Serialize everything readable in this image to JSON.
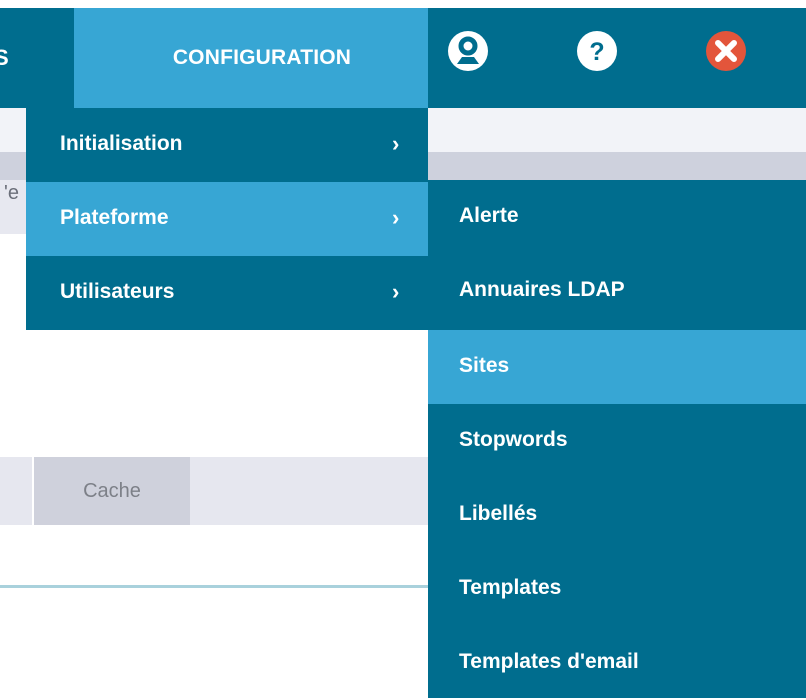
{
  "header": {
    "partial_nav_label": "S",
    "active_nav_label": "CONFIGURATION",
    "icons": [
      "user-icon",
      "help-icon",
      "close-icon"
    ]
  },
  "background": {
    "partial_text": "'e",
    "tab_label": "Cache"
  },
  "menu_level1": {
    "items": [
      {
        "label": "Initialisation",
        "chevron": "›"
      },
      {
        "label": "Plateforme",
        "chevron": "›"
      },
      {
        "label": "Utilisateurs",
        "chevron": "›"
      }
    ],
    "active": "Plateforme"
  },
  "menu_level2": {
    "items": [
      {
        "label": "Alerte"
      },
      {
        "label": "Annuaires LDAP"
      },
      {
        "label": "Sites"
      },
      {
        "label": "Stopwords"
      },
      {
        "label": "Libellés"
      },
      {
        "label": "Templates"
      },
      {
        "label": "Templates d'email"
      }
    ],
    "active": "Sites"
  },
  "colors": {
    "dark_teal": "#006d8e",
    "light_blue": "#37a6d4",
    "close_red": "#e3553b"
  }
}
